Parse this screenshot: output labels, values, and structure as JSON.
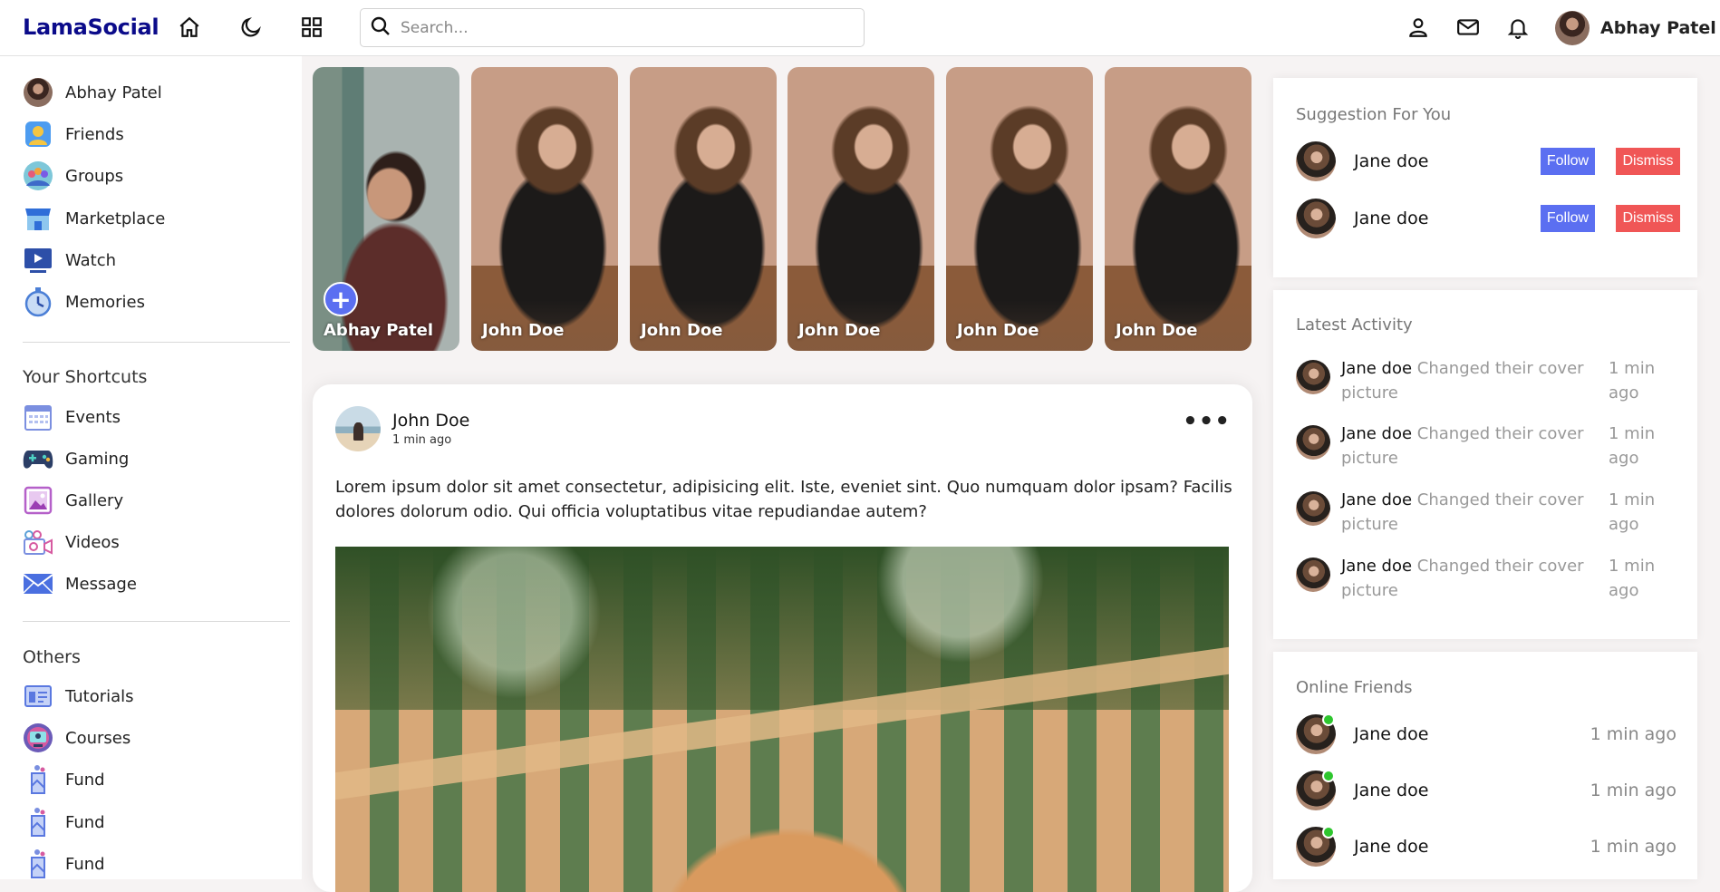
{
  "navbar": {
    "logo": "LamaSocial",
    "icons": [
      "home-icon",
      "moon-icon",
      "grid-icon",
      "user-icon",
      "mail-icon",
      "bell-icon"
    ],
    "search_placeholder": "Search...",
    "user_name": "Abhay Patel"
  },
  "leftbar": {
    "main": [
      {
        "label": "Abhay Patel",
        "icon": "avatar"
      },
      {
        "label": "Friends",
        "icon": "friends-icon"
      },
      {
        "label": "Groups",
        "icon": "groups-icon"
      },
      {
        "label": "Marketplace",
        "icon": "marketplace-icon"
      },
      {
        "label": "Watch",
        "icon": "watch-icon"
      },
      {
        "label": "Memories",
        "icon": "memories-icon"
      }
    ],
    "shortcuts_title": "Your Shortcuts",
    "shortcuts": [
      {
        "label": "Events",
        "icon": "events-icon"
      },
      {
        "label": "Gaming",
        "icon": "gaming-icon"
      },
      {
        "label": "Gallery",
        "icon": "gallery-icon"
      },
      {
        "label": "Videos",
        "icon": "videos-icon"
      },
      {
        "label": "Message",
        "icon": "message-icon"
      }
    ],
    "others_title": "Others",
    "others": [
      {
        "label": "Tutorials",
        "icon": "tutorials-icon"
      },
      {
        "label": "Courses",
        "icon": "courses-icon"
      },
      {
        "label": "Fund",
        "icon": "fund-icon"
      },
      {
        "label": "Fund",
        "icon": "fund-icon"
      },
      {
        "label": "Fund",
        "icon": "fund-icon"
      }
    ]
  },
  "stories": [
    {
      "name": "Abhay Patel",
      "own": true
    },
    {
      "name": "John Doe"
    },
    {
      "name": "John Doe"
    },
    {
      "name": "John Doe"
    },
    {
      "name": "John Doe"
    },
    {
      "name": "John Doe"
    }
  ],
  "post": {
    "author": "John Doe",
    "time": "1 min ago",
    "text": "Lorem ipsum dolor sit amet consectetur, adipisicing elit. Iste, eveniet sint. Quo numquam dolor ipsam? Facilis dolores dolorum odio. Qui officia voluptatibus vitae repudiandae autem?",
    "more_label": "•••"
  },
  "suggestions": {
    "title": "Suggestion For You",
    "items": [
      {
        "name": "Jane doe",
        "follow_label": "Follow",
        "dismiss_label": "Dismiss"
      },
      {
        "name": "Jane doe",
        "follow_label": "Follow",
        "dismiss_label": "Dismiss"
      }
    ]
  },
  "activity": {
    "title": "Latest Activity",
    "items": [
      {
        "name": "Jane doe",
        "text": "Changed their cover picture",
        "time": "1 min ago"
      },
      {
        "name": "Jane doe",
        "text": "Changed their cover picture",
        "time": "1 min ago"
      },
      {
        "name": "Jane doe",
        "text": "Changed their cover picture",
        "time": "1 min ago"
      },
      {
        "name": "Jane doe",
        "text": "Changed their cover picture",
        "time": "1 min ago"
      }
    ]
  },
  "online": {
    "title": "Online Friends",
    "items": [
      {
        "name": "Jane doe",
        "time": "1 min ago"
      },
      {
        "name": "Jane doe",
        "time": "1 min ago"
      },
      {
        "name": "Jane doe",
        "time": "1 min ago"
      }
    ]
  },
  "colors": {
    "brand": "#0b0b8a",
    "follow": "#5b6ff1",
    "dismiss": "#f05656",
    "online": "#2ec62e"
  }
}
